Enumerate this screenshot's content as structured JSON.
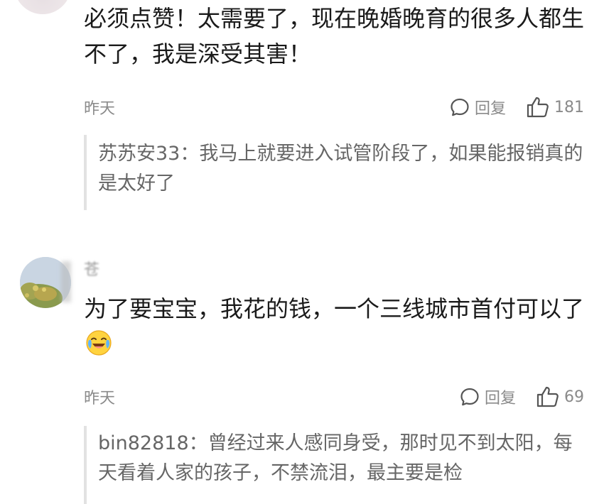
{
  "comments": [
    {
      "text": "必须点赞！太需要了，现在晚婚晚育的很多人都生不了，我是深受其害！",
      "time": "昨天",
      "reply_label": "回复",
      "likes": "181",
      "sub_reply": {
        "user": "苏苏安33：",
        "text": "我马上就要进入试管阶段了，如果能报销真的是太好了"
      }
    },
    {
      "username_partial": "苍",
      "text": "为了要宝宝，我花的钱，一个三线城市首付可以了",
      "emoji": "crying-laughing-emoji",
      "time": "昨天",
      "reply_label": "回复",
      "likes": "69",
      "sub_reply": {
        "user": "bin82818：",
        "text": "曾经过来人感同身受，那时见不到太阳，每天看着人家的孩子，不禁流泪，最主要是检"
      }
    }
  ],
  "colors": {
    "text": "#1a1a1a",
    "meta": "#8a8a8a",
    "sub_text": "#666666",
    "sub_border": "#e2e2e2"
  }
}
